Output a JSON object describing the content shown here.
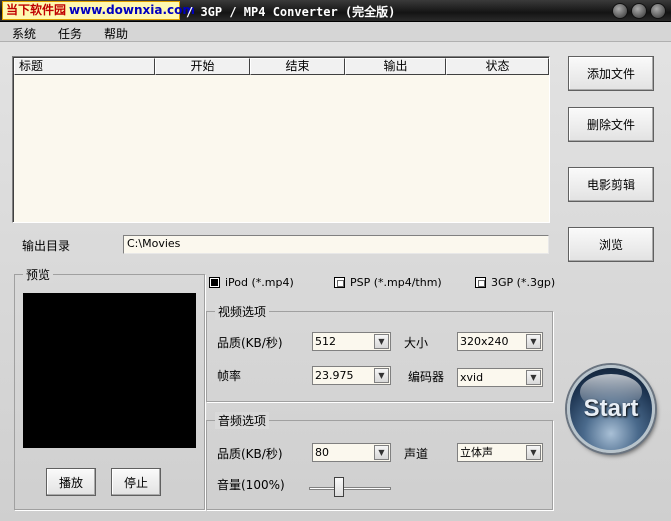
{
  "titlebar": {
    "watermark_cn": "当下软件园",
    "watermark_url": "www.downxia.com",
    "title": "/ 3GP / MP4 Converter (完全版)"
  },
  "menu": [
    "系统",
    "任务",
    "帮助"
  ],
  "table": {
    "columns": [
      "标题",
      "开始",
      "结束",
      "输出",
      "状态"
    ]
  },
  "side_buttons": {
    "add_file": "添加文件",
    "delete_file": "删除文件",
    "movie_clip": "电影剪辑",
    "browse": "浏览"
  },
  "output": {
    "label": "输出目录",
    "value": "C:\\Movies"
  },
  "preview": {
    "title": "预览",
    "play": "播放",
    "stop": "停止"
  },
  "formats": [
    {
      "label": "iPod (*.mp4)",
      "checked": true
    },
    {
      "label": "PSP (*.mp4/thm)",
      "checked": false
    },
    {
      "label": "3GP (*.3gp)",
      "checked": false
    }
  ],
  "video": {
    "title": "视频选项",
    "quality_label": "品质(KB/秒)",
    "quality_value": "512",
    "size_label": "大小",
    "size_value": "320x240",
    "framerate_label": "帧率",
    "framerate_value": "23.975",
    "encoder_label": "编码器",
    "encoder_value": "xvid"
  },
  "audio": {
    "title": "音频选项",
    "quality_label": "品质(KB/秒)",
    "quality_value": "80",
    "channel_label": "声道",
    "channel_value": "立体声",
    "volume_label": "音量(100%)",
    "volume_level": 0.35
  },
  "start_label": "Start"
}
